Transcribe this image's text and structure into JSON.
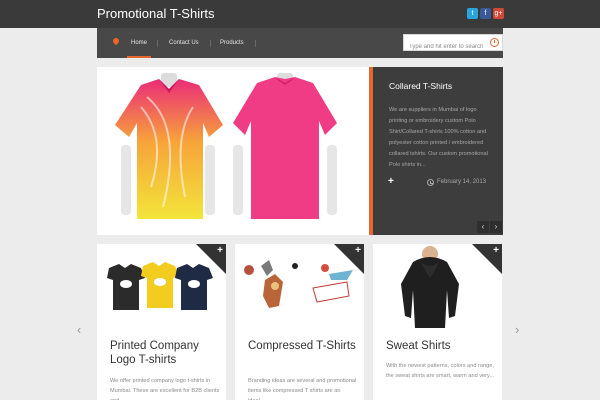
{
  "header": {
    "site_title": "Promotional T-Shirts",
    "social": [
      {
        "icon": "twitter-icon",
        "glyph": "t",
        "color": "#2aa4dc"
      },
      {
        "icon": "facebook-icon",
        "glyph": "f",
        "color": "#3b5998"
      },
      {
        "icon": "google-plus-icon",
        "glyph": "g+",
        "color": "#d14836"
      }
    ]
  },
  "nav": {
    "items": [
      {
        "label": "Home",
        "active": true
      },
      {
        "label": "Contact Us",
        "active": false
      },
      {
        "label": "Products",
        "active": false
      }
    ],
    "search_placeholder": "Type and hit enter to search"
  },
  "hero": {
    "title": "Collared T-Shirts",
    "description": "We are suppliers in Mumbai of logo printing or embroidery custom Polo Shirt/Collared T-shirts 100% cotton and polyester cotton printed / embroidered collared tshirts. Our custom promotional Polo shirts in...",
    "date": "February 14, 2013",
    "plus": "+",
    "prev": "‹",
    "next": "›"
  },
  "cards": [
    {
      "title": "Printed Company Logo T-shirts",
      "text": "We offer printed company logo t-shirts in Mumbai. These are excellent for B2B clients and...",
      "plus": "+"
    },
    {
      "title": "Compressed T-Shirts",
      "text": "Branding ideas are several and promotional items like compressed T shirts are an ideal...",
      "plus": "+"
    },
    {
      "title": "Sweat Shirts",
      "text": "With the newest patterns, colors and range, the sweat shirts are smart, warm and very...",
      "plus": "+"
    }
  ],
  "carousel": {
    "prev": "‹",
    "next": "›"
  },
  "colors": {
    "accent": "#e8652b",
    "header_bg": "#3a3a3a",
    "nav_bg": "#484848",
    "panel_bg": "#3d3d3d"
  }
}
